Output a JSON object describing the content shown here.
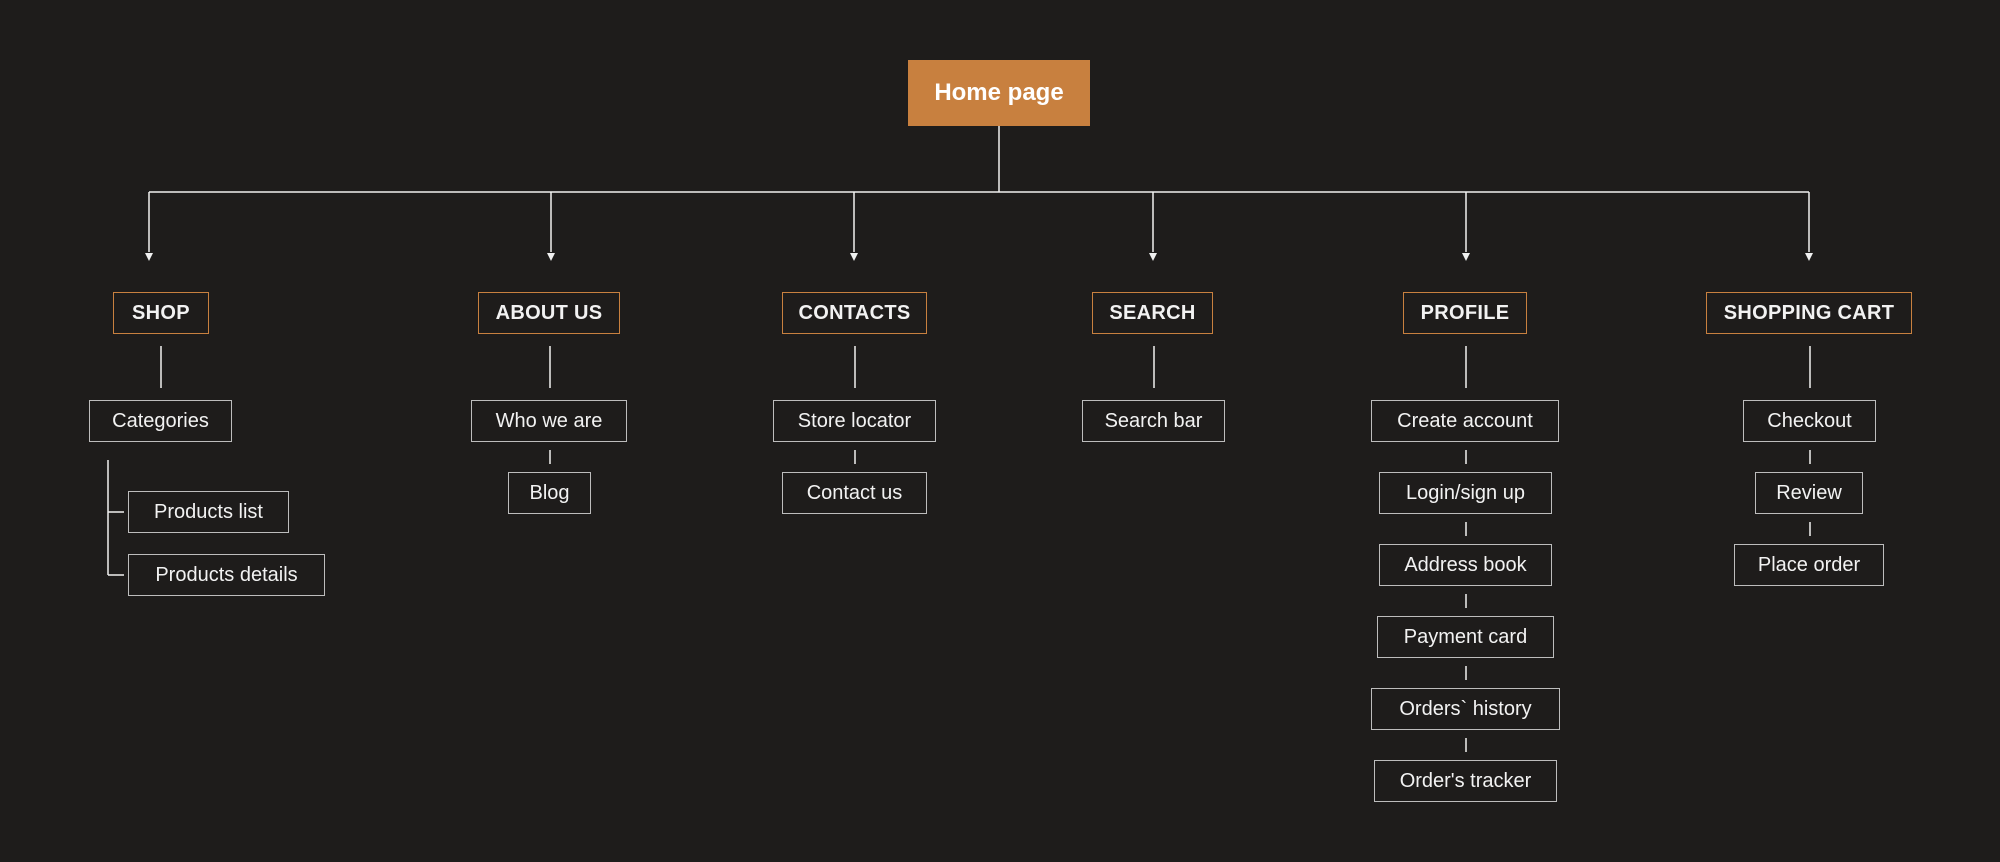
{
  "colors": {
    "background": "#1e1c1b",
    "accent": "#c8803f",
    "line": "#f0f0f0",
    "node_border": "#bdbdbd",
    "text": "#f2f2f2"
  },
  "root": {
    "label": "Home page"
  },
  "sections": [
    {
      "id": "shop",
      "label": "SHOP",
      "pages": [
        "Categories"
      ],
      "subpages": [
        "Products list",
        "Products details"
      ]
    },
    {
      "id": "about-us",
      "label": "ABOUT US",
      "pages": [
        "Who we are",
        "Blog"
      ]
    },
    {
      "id": "contacts",
      "label": "CONTACTS",
      "pages": [
        "Store locator",
        "Contact us"
      ]
    },
    {
      "id": "search",
      "label": "SEARCH",
      "pages": [
        "Search bar"
      ]
    },
    {
      "id": "profile",
      "label": "PROFILE",
      "pages": [
        "Create account",
        "Login/sign up",
        "Address book",
        "Payment card",
        "Orders` history",
        "Order's tracker"
      ]
    },
    {
      "id": "shopping-cart",
      "label": "SHOPPING CART",
      "pages": [
        "Checkout",
        "Review",
        "Place order"
      ]
    }
  ]
}
